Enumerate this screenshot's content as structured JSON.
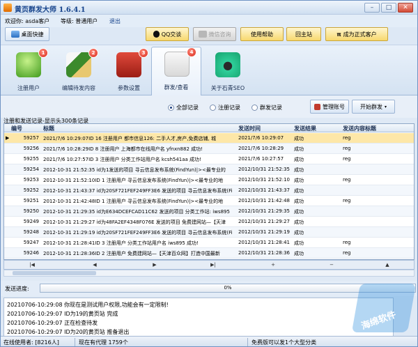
{
  "window": {
    "title": "黄页群发大师 1.6.4.1"
  },
  "info": {
    "welcome": "欢迎你: asda客户",
    "level": "等级: 普通用户",
    "logout": "退出"
  },
  "toolbar": {
    "desktop": "桌面快捷",
    "qq": "QQ交谈",
    "wechat": "微信咨询",
    "help": "使用帮助",
    "site": "回主站",
    "upgrade": "成为正式客户"
  },
  "tabs": [
    {
      "label": "注册用户",
      "num": "1"
    },
    {
      "label": "编辑待发内容",
      "num": "2"
    },
    {
      "label": "参数设置",
      "num": "3"
    },
    {
      "label": "群发/查看",
      "num": "4"
    },
    {
      "label": "关于石青SEO",
      "num": ""
    }
  ],
  "filters": {
    "all": "全部记录",
    "register": "注册记录",
    "publish": "群发记录",
    "manage": "管理账号",
    "start": "开始群发"
  },
  "section_label": "注册和发送记录-显示头300条记录",
  "table": {
    "headers": [
      "编号",
      "标题",
      "发送时间",
      "发送结果",
      "发送内容标题"
    ],
    "rows": [
      [
        "59257",
        "2021/7/6 10:29:07ID 16 注册用户 都市信息126: 二手人才,房产,免费店铺, 城",
        "2021/7/6 10:29:07",
        "成功",
        "reg"
      ],
      [
        "59256",
        "2021/7/6 10:28:29ID 8 注册用户 上海都市在线用户名 yfnxn882 成功!",
        "2021/7/6 10:28:29",
        "成功",
        "reg"
      ],
      [
        "59255",
        "2021/7/6 10:27:57ID 3 注册用户 分类工作站用户名 kcsh541aa 成功!",
        "2021/7/6 10:27:57",
        "成功",
        "reg"
      ],
      [
        "59254",
        "2012-10-31 21:52:35 id为1发送的项目 寻云信息发布系统(FindYun)|><最专业的",
        "2012/10/31 21:52:35",
        "成功",
        ""
      ],
      [
        "59253",
        "2012-10-31 21:52:10ID 1 注册用户 寻云信息发布系统(FindYun)|><最专业的地",
        "2012/10/31 21:52:10",
        "成功",
        "reg"
      ],
      [
        "59252",
        "2012-10-31 21:43:37 id为20SF721FEF249FF3E6 发送的项目 寻云信息发布系统(Fi",
        "2012/10/31 21:43:37",
        "成功",
        ""
      ],
      [
        "59251",
        "2012-10-31 21:42:48ID 1 注册用户 寻云信息发布系统(FindYun)|><最专业的地",
        "2012/10/31 21:42:48",
        "成功",
        "reg"
      ],
      [
        "59250",
        "2012-10-31 21:29:35 id为E634DCEFCAD11C62 发送的项目 分类工作站: iws895",
        "2012/10/31 21:29:35",
        "成功",
        ""
      ],
      [
        "59249",
        "2012-10-31 21:29:27 id为48FA2EF4348F076E 发送的项目 免费建网站—【天津",
        "2012/10/31 21:29:27",
        "成功",
        ""
      ],
      [
        "59248",
        "2012-10-31 21:29:19 id为20SF721FEF249FF3E6 发送的项目 寻云信息发布系统(Fi",
        "2012/10/31 21:29:19",
        "成功",
        ""
      ],
      [
        "59247",
        "2012-10-31 21:28:41ID 3 注册用户 分类工作站用户名 iws895 成功!",
        "2012/10/31 21:28:41",
        "成功",
        "reg"
      ],
      [
        "59246",
        "2012-10-31 21:28:36ID 2 注册用户 免费建网站—【天津百众网】打造中国最新",
        "2012/10/31 21:28:36",
        "成功",
        "reg"
      ]
    ]
  },
  "progress": {
    "label": "发送进度:",
    "value": "0%"
  },
  "log": [
    "20210706-10:29:08  你现在是测试用户权限,功能会有一定限制!",
    "20210706-10:29:07  ID为19的黄页站 完成",
    "20210706-10:29:07  正在检查待发",
    "20210706-10:29:07  ID为20的黄页站 推备退出"
  ],
  "status": {
    "online": "在线使用者: [8216人]",
    "proxy": "现在有代理 1759个",
    "notice": "免费版可以发1个大型分类"
  },
  "watermark": {
    "text": "海绵软件"
  },
  "colors": {
    "accent": "#15428b",
    "selected_row": "#fde7a8"
  }
}
